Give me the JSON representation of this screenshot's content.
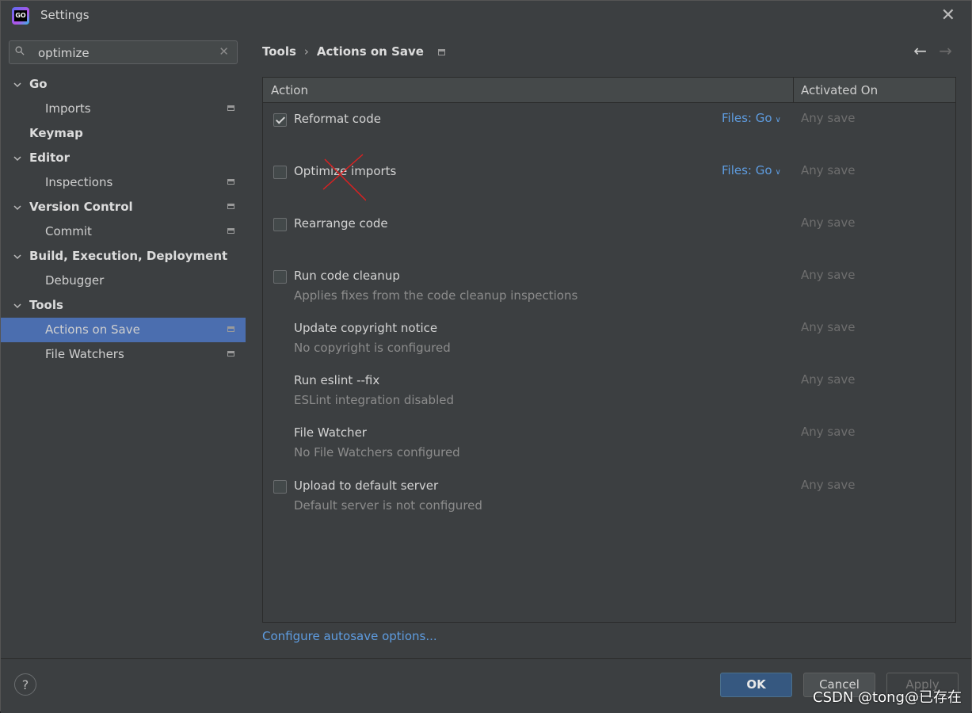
{
  "window": {
    "title": "Settings",
    "close_icon": "✕"
  },
  "search": {
    "value": "optimize",
    "clear_icon": "✕"
  },
  "tree": [
    {
      "label": "Go",
      "level": 0,
      "expanded": true,
      "page_icon": false
    },
    {
      "label": "Imports",
      "level": 1,
      "page_icon": true
    },
    {
      "label": "Keymap",
      "level": 0,
      "expanded": null,
      "page_icon": false
    },
    {
      "label": "Editor",
      "level": 0,
      "expanded": true,
      "page_icon": false
    },
    {
      "label": "Inspections",
      "level": 1,
      "page_icon": true
    },
    {
      "label": "Version Control",
      "level": 0,
      "expanded": true,
      "page_icon": true
    },
    {
      "label": "Commit",
      "level": 1,
      "page_icon": true
    },
    {
      "label": "Build, Execution, Deployment",
      "level": 0,
      "expanded": true,
      "page_icon": false
    },
    {
      "label": "Debugger",
      "level": 1,
      "page_icon": false
    },
    {
      "label": "Tools",
      "level": 0,
      "expanded": true,
      "page_icon": false
    },
    {
      "label": "Actions on Save",
      "level": 1,
      "page_icon": true,
      "selected": true
    },
    {
      "label": "File Watchers",
      "level": 1,
      "page_icon": true
    }
  ],
  "breadcrumb": {
    "parent": "Tools",
    "separator": "›",
    "current": "Actions on Save"
  },
  "nav": {
    "back": "←",
    "forward": "→"
  },
  "table": {
    "col_action": "Action",
    "col_activated": "Activated On",
    "rows": [
      {
        "name": "Reformat code",
        "sub": "",
        "checkbox": true,
        "checked": true,
        "files": "Files: Go",
        "activated": "Any save"
      },
      {
        "name": "Optimize imports",
        "sub": "",
        "checkbox": true,
        "checked": false,
        "files": "Files: Go",
        "activated": "Any save"
      },
      {
        "name": "Rearrange code",
        "sub": "",
        "checkbox": true,
        "checked": false,
        "files": "",
        "activated": "Any save"
      },
      {
        "name": "Run code cleanup",
        "sub": "Applies fixes from the code cleanup inspections",
        "checkbox": true,
        "checked": false,
        "files": "",
        "activated": "Any save"
      },
      {
        "name": "Update copyright notice",
        "sub": "No copyright is configured",
        "checkbox": false,
        "checked": false,
        "files": "",
        "activated": "Any save"
      },
      {
        "name": "Run eslint --fix",
        "sub": "ESLint integration disabled",
        "checkbox": false,
        "checked": false,
        "files": "",
        "activated": "Any save"
      },
      {
        "name": "File Watcher",
        "sub": "No File Watchers configured",
        "checkbox": false,
        "checked": false,
        "files": "",
        "activated": "Any save"
      },
      {
        "name": "Upload to default server",
        "sub": "Default server is not configured",
        "checkbox": true,
        "checked": false,
        "files": "",
        "activated": "Any save"
      }
    ]
  },
  "autosave_link": "Configure autosave options...",
  "footer": {
    "help": "?",
    "ok": "OK",
    "cancel": "Cancel",
    "apply": "Apply"
  },
  "watermark": "CSDN @tong@已存在",
  "colors": {
    "accent": "#4b6eaf",
    "link": "#5e9ce0",
    "annotation": "#e02020"
  }
}
